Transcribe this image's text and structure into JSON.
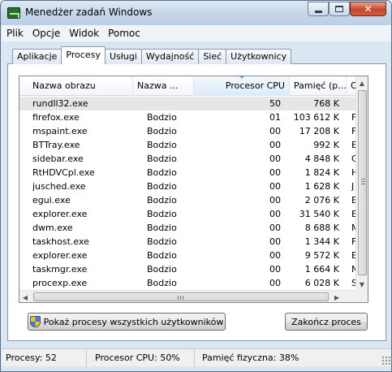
{
  "window": {
    "title": "Menedżer zadań Windows",
    "icon": "task-manager-icon"
  },
  "menu": [
    "Plik",
    "Opcje",
    "Widok",
    "Pomoc"
  ],
  "tabs": [
    {
      "label": "Aplikacje",
      "active": false
    },
    {
      "label": "Procesy",
      "active": true
    },
    {
      "label": "Usługi",
      "active": false
    },
    {
      "label": "Wydajność",
      "active": false
    },
    {
      "label": "Sieć",
      "active": false
    },
    {
      "label": "Użytkownicy",
      "active": false
    }
  ],
  "table": {
    "columns": {
      "name": "Nazwa obrazu",
      "user": "Nazwa ...",
      "cpu": "Procesor CPU",
      "mem": "Pamięć (p...",
      "desc": "O"
    },
    "sorted_column": "cpu",
    "selected_row": 0,
    "rows": [
      {
        "name": "rundll32.exe",
        "user": "",
        "cpu": "50",
        "mem": "768 K",
        "desc": ""
      },
      {
        "name": "firefox.exe",
        "user": "Bodzio",
        "cpu": "01",
        "mem": "103 612 K",
        "desc": "F"
      },
      {
        "name": "mspaint.exe",
        "user": "Bodzio",
        "cpu": "00",
        "mem": "17 208 K",
        "desc": "F"
      },
      {
        "name": "BTTray.exe",
        "user": "Bodzio",
        "cpu": "00",
        "mem": "992 K",
        "desc": "E"
      },
      {
        "name": "sidebar.exe",
        "user": "Bodzio",
        "cpu": "00",
        "mem": "4 848 K",
        "desc": "G"
      },
      {
        "name": "RtHDVCpl.exe",
        "user": "Bodzio",
        "cpu": "00",
        "mem": "1 824 K",
        "desc": "H"
      },
      {
        "name": "jusched.exe",
        "user": "Bodzio",
        "cpu": "00",
        "mem": "1 628 K",
        "desc": "J"
      },
      {
        "name": "egui.exe",
        "user": "Bodzio",
        "cpu": "00",
        "mem": "2 076 K",
        "desc": "E"
      },
      {
        "name": "explorer.exe",
        "user": "Bodzio",
        "cpu": "00",
        "mem": "31 540 K",
        "desc": "E"
      },
      {
        "name": "dwm.exe",
        "user": "Bodzio",
        "cpu": "00",
        "mem": "8 688 K",
        "desc": "M"
      },
      {
        "name": "taskhost.exe",
        "user": "Bodzio",
        "cpu": "00",
        "mem": "1 344 K",
        "desc": "F"
      },
      {
        "name": "explorer.exe",
        "user": "Bodzio",
        "cpu": "00",
        "mem": "9 572 K",
        "desc": "E"
      },
      {
        "name": "taskmgr.exe",
        "user": "Bodzio",
        "cpu": "00",
        "mem": "1 664 K",
        "desc": "N"
      },
      {
        "name": "procexp.exe",
        "user": "Bodzio",
        "cpu": "00",
        "mem": "6 028 K",
        "desc": "S"
      }
    ]
  },
  "buttons": {
    "show_all": "Pokaż procesy wszystkich użytkowników",
    "end_process": "Zakończ proces"
  },
  "status": {
    "processes": "Procesy: 52",
    "cpu": "Procesor CPU: 50%",
    "memory": "Pamięć fizyczna: 38%"
  },
  "colors": {
    "selection": "#e6e6e6",
    "sorted_header": "#dcebf8",
    "close_button": "#c7452b"
  }
}
